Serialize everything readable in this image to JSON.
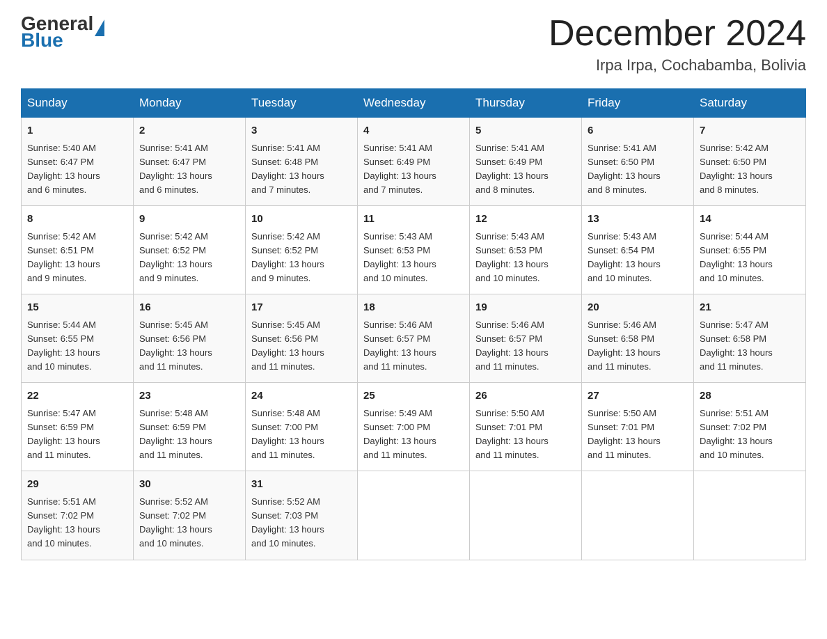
{
  "logo": {
    "text_general": "General",
    "triangle_label": "logo-triangle",
    "text_blue": "Blue"
  },
  "header": {
    "title": "December 2024",
    "subtitle": "Irpa Irpa, Cochabamba, Bolivia"
  },
  "weekdays": [
    "Sunday",
    "Monday",
    "Tuesday",
    "Wednesday",
    "Thursday",
    "Friday",
    "Saturday"
  ],
  "weeks": [
    [
      {
        "day": "1",
        "info": "Sunrise: 5:40 AM\nSunset: 6:47 PM\nDaylight: 13 hours\nand 6 minutes."
      },
      {
        "day": "2",
        "info": "Sunrise: 5:41 AM\nSunset: 6:47 PM\nDaylight: 13 hours\nand 6 minutes."
      },
      {
        "day": "3",
        "info": "Sunrise: 5:41 AM\nSunset: 6:48 PM\nDaylight: 13 hours\nand 7 minutes."
      },
      {
        "day": "4",
        "info": "Sunrise: 5:41 AM\nSunset: 6:49 PM\nDaylight: 13 hours\nand 7 minutes."
      },
      {
        "day": "5",
        "info": "Sunrise: 5:41 AM\nSunset: 6:49 PM\nDaylight: 13 hours\nand 8 minutes."
      },
      {
        "day": "6",
        "info": "Sunrise: 5:41 AM\nSunset: 6:50 PM\nDaylight: 13 hours\nand 8 minutes."
      },
      {
        "day": "7",
        "info": "Sunrise: 5:42 AM\nSunset: 6:50 PM\nDaylight: 13 hours\nand 8 minutes."
      }
    ],
    [
      {
        "day": "8",
        "info": "Sunrise: 5:42 AM\nSunset: 6:51 PM\nDaylight: 13 hours\nand 9 minutes."
      },
      {
        "day": "9",
        "info": "Sunrise: 5:42 AM\nSunset: 6:52 PM\nDaylight: 13 hours\nand 9 minutes."
      },
      {
        "day": "10",
        "info": "Sunrise: 5:42 AM\nSunset: 6:52 PM\nDaylight: 13 hours\nand 9 minutes."
      },
      {
        "day": "11",
        "info": "Sunrise: 5:43 AM\nSunset: 6:53 PM\nDaylight: 13 hours\nand 10 minutes."
      },
      {
        "day": "12",
        "info": "Sunrise: 5:43 AM\nSunset: 6:53 PM\nDaylight: 13 hours\nand 10 minutes."
      },
      {
        "day": "13",
        "info": "Sunrise: 5:43 AM\nSunset: 6:54 PM\nDaylight: 13 hours\nand 10 minutes."
      },
      {
        "day": "14",
        "info": "Sunrise: 5:44 AM\nSunset: 6:55 PM\nDaylight: 13 hours\nand 10 minutes."
      }
    ],
    [
      {
        "day": "15",
        "info": "Sunrise: 5:44 AM\nSunset: 6:55 PM\nDaylight: 13 hours\nand 10 minutes."
      },
      {
        "day": "16",
        "info": "Sunrise: 5:45 AM\nSunset: 6:56 PM\nDaylight: 13 hours\nand 11 minutes."
      },
      {
        "day": "17",
        "info": "Sunrise: 5:45 AM\nSunset: 6:56 PM\nDaylight: 13 hours\nand 11 minutes."
      },
      {
        "day": "18",
        "info": "Sunrise: 5:46 AM\nSunset: 6:57 PM\nDaylight: 13 hours\nand 11 minutes."
      },
      {
        "day": "19",
        "info": "Sunrise: 5:46 AM\nSunset: 6:57 PM\nDaylight: 13 hours\nand 11 minutes."
      },
      {
        "day": "20",
        "info": "Sunrise: 5:46 AM\nSunset: 6:58 PM\nDaylight: 13 hours\nand 11 minutes."
      },
      {
        "day": "21",
        "info": "Sunrise: 5:47 AM\nSunset: 6:58 PM\nDaylight: 13 hours\nand 11 minutes."
      }
    ],
    [
      {
        "day": "22",
        "info": "Sunrise: 5:47 AM\nSunset: 6:59 PM\nDaylight: 13 hours\nand 11 minutes."
      },
      {
        "day": "23",
        "info": "Sunrise: 5:48 AM\nSunset: 6:59 PM\nDaylight: 13 hours\nand 11 minutes."
      },
      {
        "day": "24",
        "info": "Sunrise: 5:48 AM\nSunset: 7:00 PM\nDaylight: 13 hours\nand 11 minutes."
      },
      {
        "day": "25",
        "info": "Sunrise: 5:49 AM\nSunset: 7:00 PM\nDaylight: 13 hours\nand 11 minutes."
      },
      {
        "day": "26",
        "info": "Sunrise: 5:50 AM\nSunset: 7:01 PM\nDaylight: 13 hours\nand 11 minutes."
      },
      {
        "day": "27",
        "info": "Sunrise: 5:50 AM\nSunset: 7:01 PM\nDaylight: 13 hours\nand 11 minutes."
      },
      {
        "day": "28",
        "info": "Sunrise: 5:51 AM\nSunset: 7:02 PM\nDaylight: 13 hours\nand 10 minutes."
      }
    ],
    [
      {
        "day": "29",
        "info": "Sunrise: 5:51 AM\nSunset: 7:02 PM\nDaylight: 13 hours\nand 10 minutes."
      },
      {
        "day": "30",
        "info": "Sunrise: 5:52 AM\nSunset: 7:02 PM\nDaylight: 13 hours\nand 10 minutes."
      },
      {
        "day": "31",
        "info": "Sunrise: 5:52 AM\nSunset: 7:03 PM\nDaylight: 13 hours\nand 10 minutes."
      },
      {
        "day": "",
        "info": ""
      },
      {
        "day": "",
        "info": ""
      },
      {
        "day": "",
        "info": ""
      },
      {
        "day": "",
        "info": ""
      }
    ]
  ]
}
